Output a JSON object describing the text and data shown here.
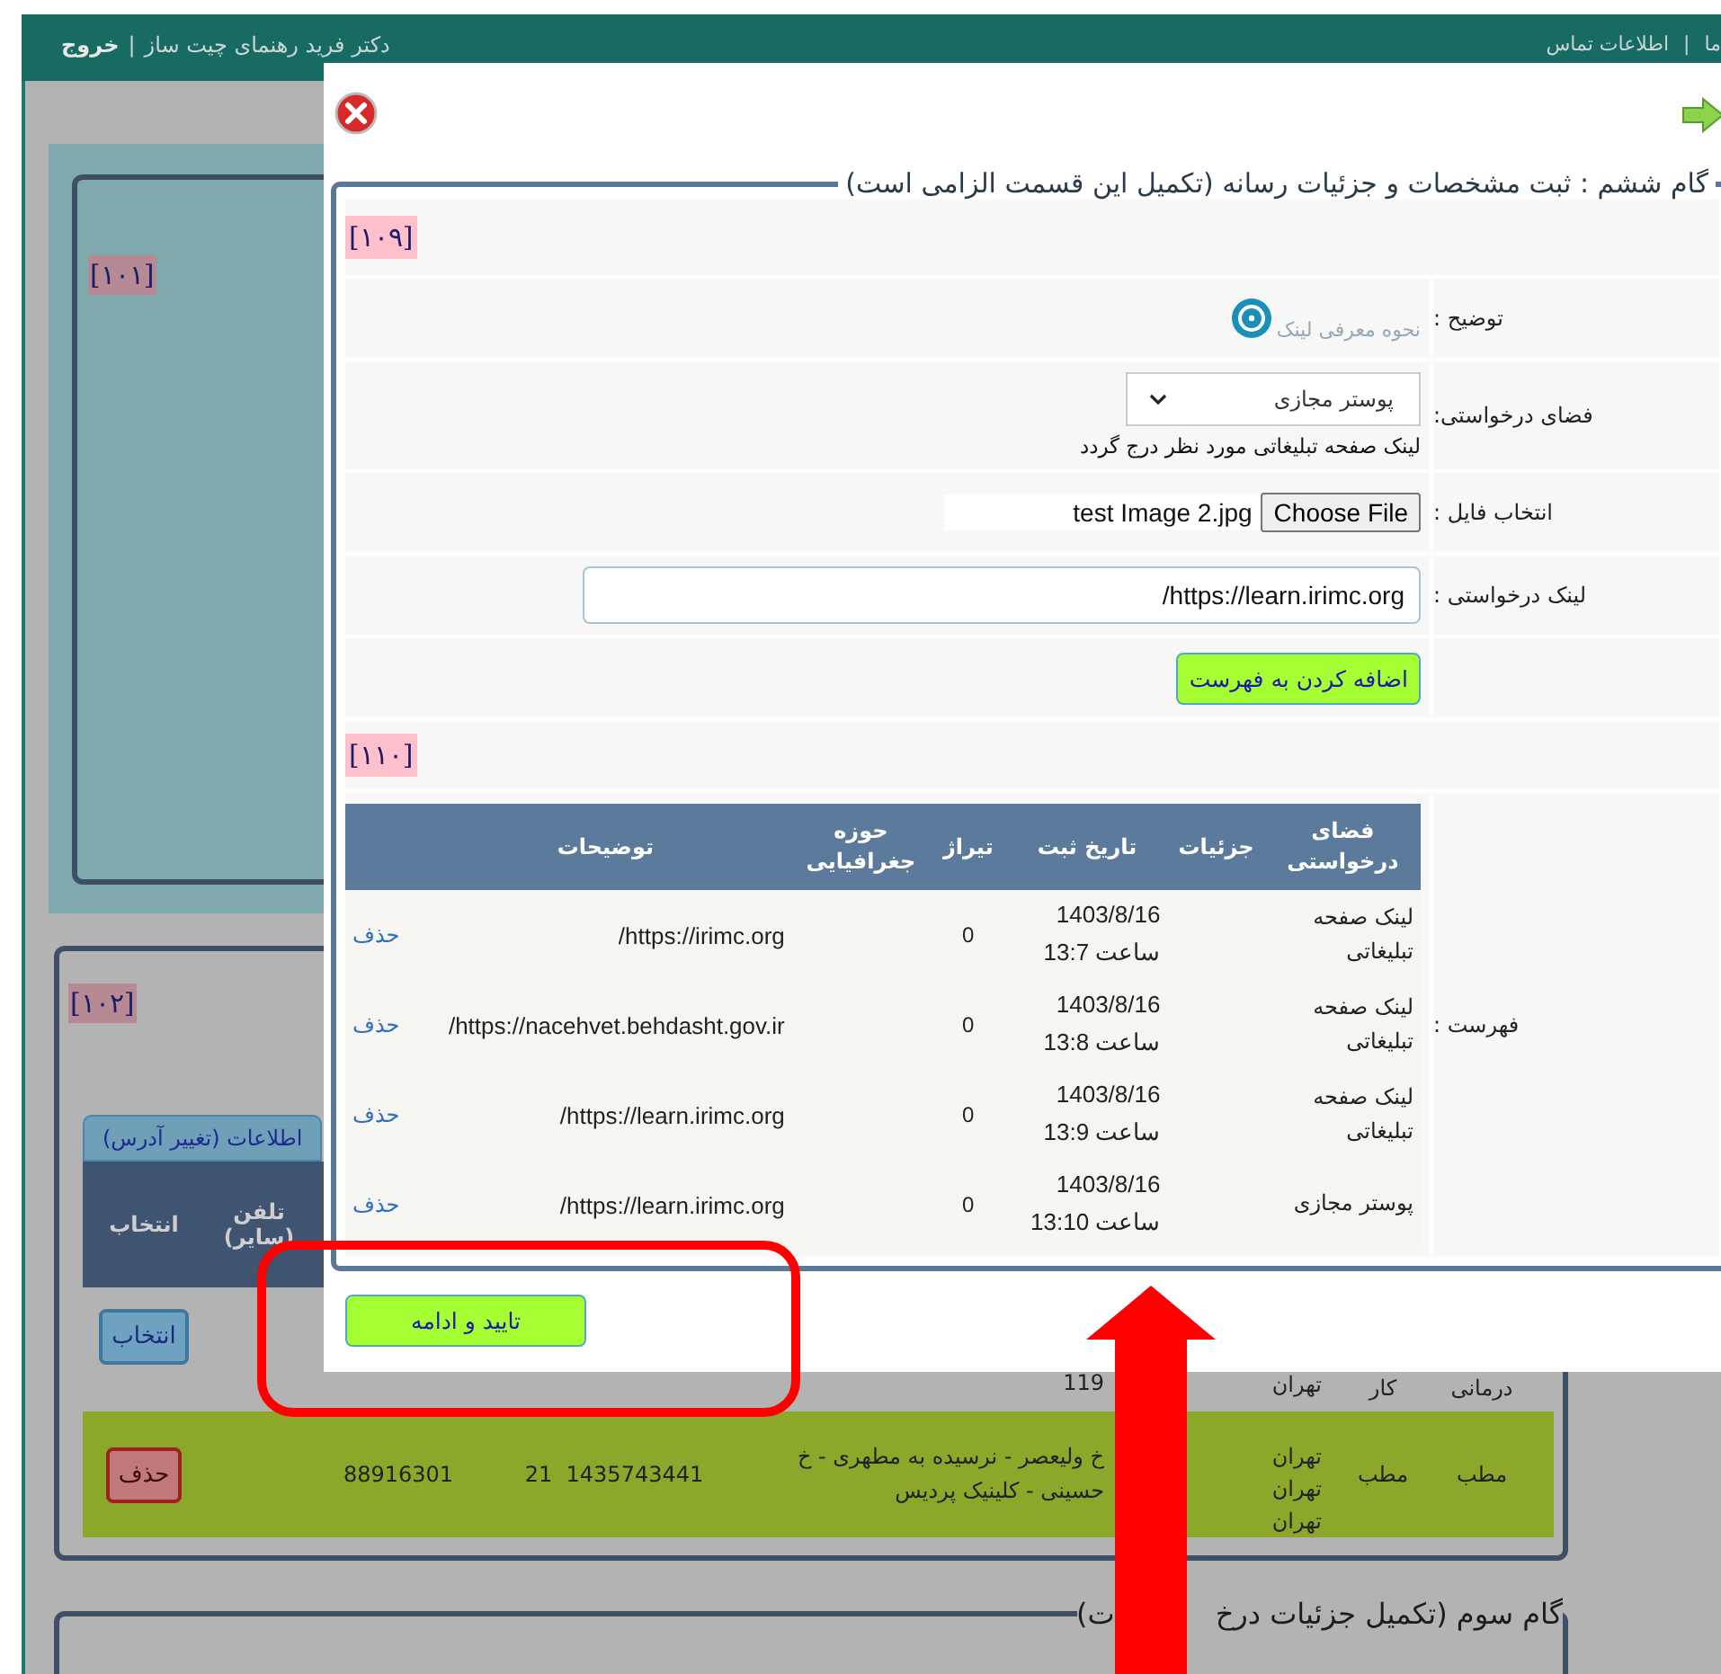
{
  "header": {
    "user_name": "دکتر فرید رهنمای چیت ساز",
    "separator": "|",
    "logout": "خروج",
    "links": [
      "ما",
      "اطلاعات تماس"
    ]
  },
  "background": {
    "panel_badges": [
      "[۱۰۱]",
      "[۱۰۲]"
    ],
    "tab": "اطلاعات (تغییر آدرس)",
    "table": {
      "columns": [
        "تلفن (سایر)",
        "انتخاب"
      ],
      "rows": [
        {
          "selected": false,
          "kind": "select",
          "action": "انتخاب",
          "address": "119",
          "city_lines": [
            "تهران"
          ],
          "column_7": "کار",
          "column_8": "درمانی"
        },
        {
          "selected": true,
          "kind": "delete",
          "action": "حذف",
          "phone_other": "88916301",
          "phone": "21  1435743441",
          "address": "خ ولیعصر - نرسیده به مطهری - خ حسینی - کلینیک پردیس",
          "city_lines": [
            "تهران",
            "تهران",
            "تهران"
          ],
          "column_7": "مطب",
          "column_8": "مطب"
        }
      ]
    },
    "next_step_legend": "گام سوم (تکمیل جزئیات درخ",
    "next_step_legend_tail": "ت)"
  },
  "dialog": {
    "legend": "گام ششم : ثبت مشخصات و جزئیات رسانه (تکمیل این قسمت الزامی است)",
    "badges": [
      "[۱۰۹]",
      "[۱۱۰]"
    ],
    "form_rows": [
      {
        "kind": "help",
        "label": "توضیح :",
        "hint": "نحوه معرفی لینک"
      },
      {
        "kind": "select",
        "label": "فضای درخواستی:",
        "value": "پوستر مجازی",
        "note": "لینک صفحه تبلیغاتی مورد نظر درج گردد"
      },
      {
        "kind": "file",
        "label": "انتخاب فایل :",
        "button": "Choose File",
        "file_name": "test Image 2.jpg"
      },
      {
        "kind": "input",
        "label": "لینک درخواستی :",
        "value": "https://learn.irimc.org/"
      },
      {
        "kind": "button",
        "label": "",
        "button": "اضافه کردن به فهرست"
      }
    ],
    "list_label": "فهرست :",
    "list_table": {
      "columns": [
        "فضای درخواستی",
        "جزئیات",
        "تاریخ ثبت",
        "تیراژ",
        "حوزه جغرافیایی",
        "توضیحات"
      ],
      "rows": [
        {
          "space": "لینک صفحه تبلیغاتی",
          "date": "1403/8/16",
          "time": "ساعت 13:7",
          "count": "0",
          "description": "https://irimc.org/",
          "action": "حذف"
        },
        {
          "space": "لینک صفحه تبلیغاتی",
          "date": "1403/8/16",
          "time": "ساعت 13:8",
          "count": "0",
          "description": "https://nacehvet.behdasht.gov.ir/",
          "action": "حذف"
        },
        {
          "space": "لینک صفحه تبلیغاتی",
          "date": "1403/8/16",
          "time": "ساعت 13:9",
          "count": "0",
          "description": "https://learn.irimc.org/",
          "action": "حذف"
        },
        {
          "space": "پوستر مجازی",
          "date": "1403/8/16",
          "time": "ساعت 13:10",
          "count": "0",
          "description": "https://learn.irimc.org/",
          "action": "حذف"
        }
      ]
    },
    "confirm_button": "تایید و ادامه"
  }
}
